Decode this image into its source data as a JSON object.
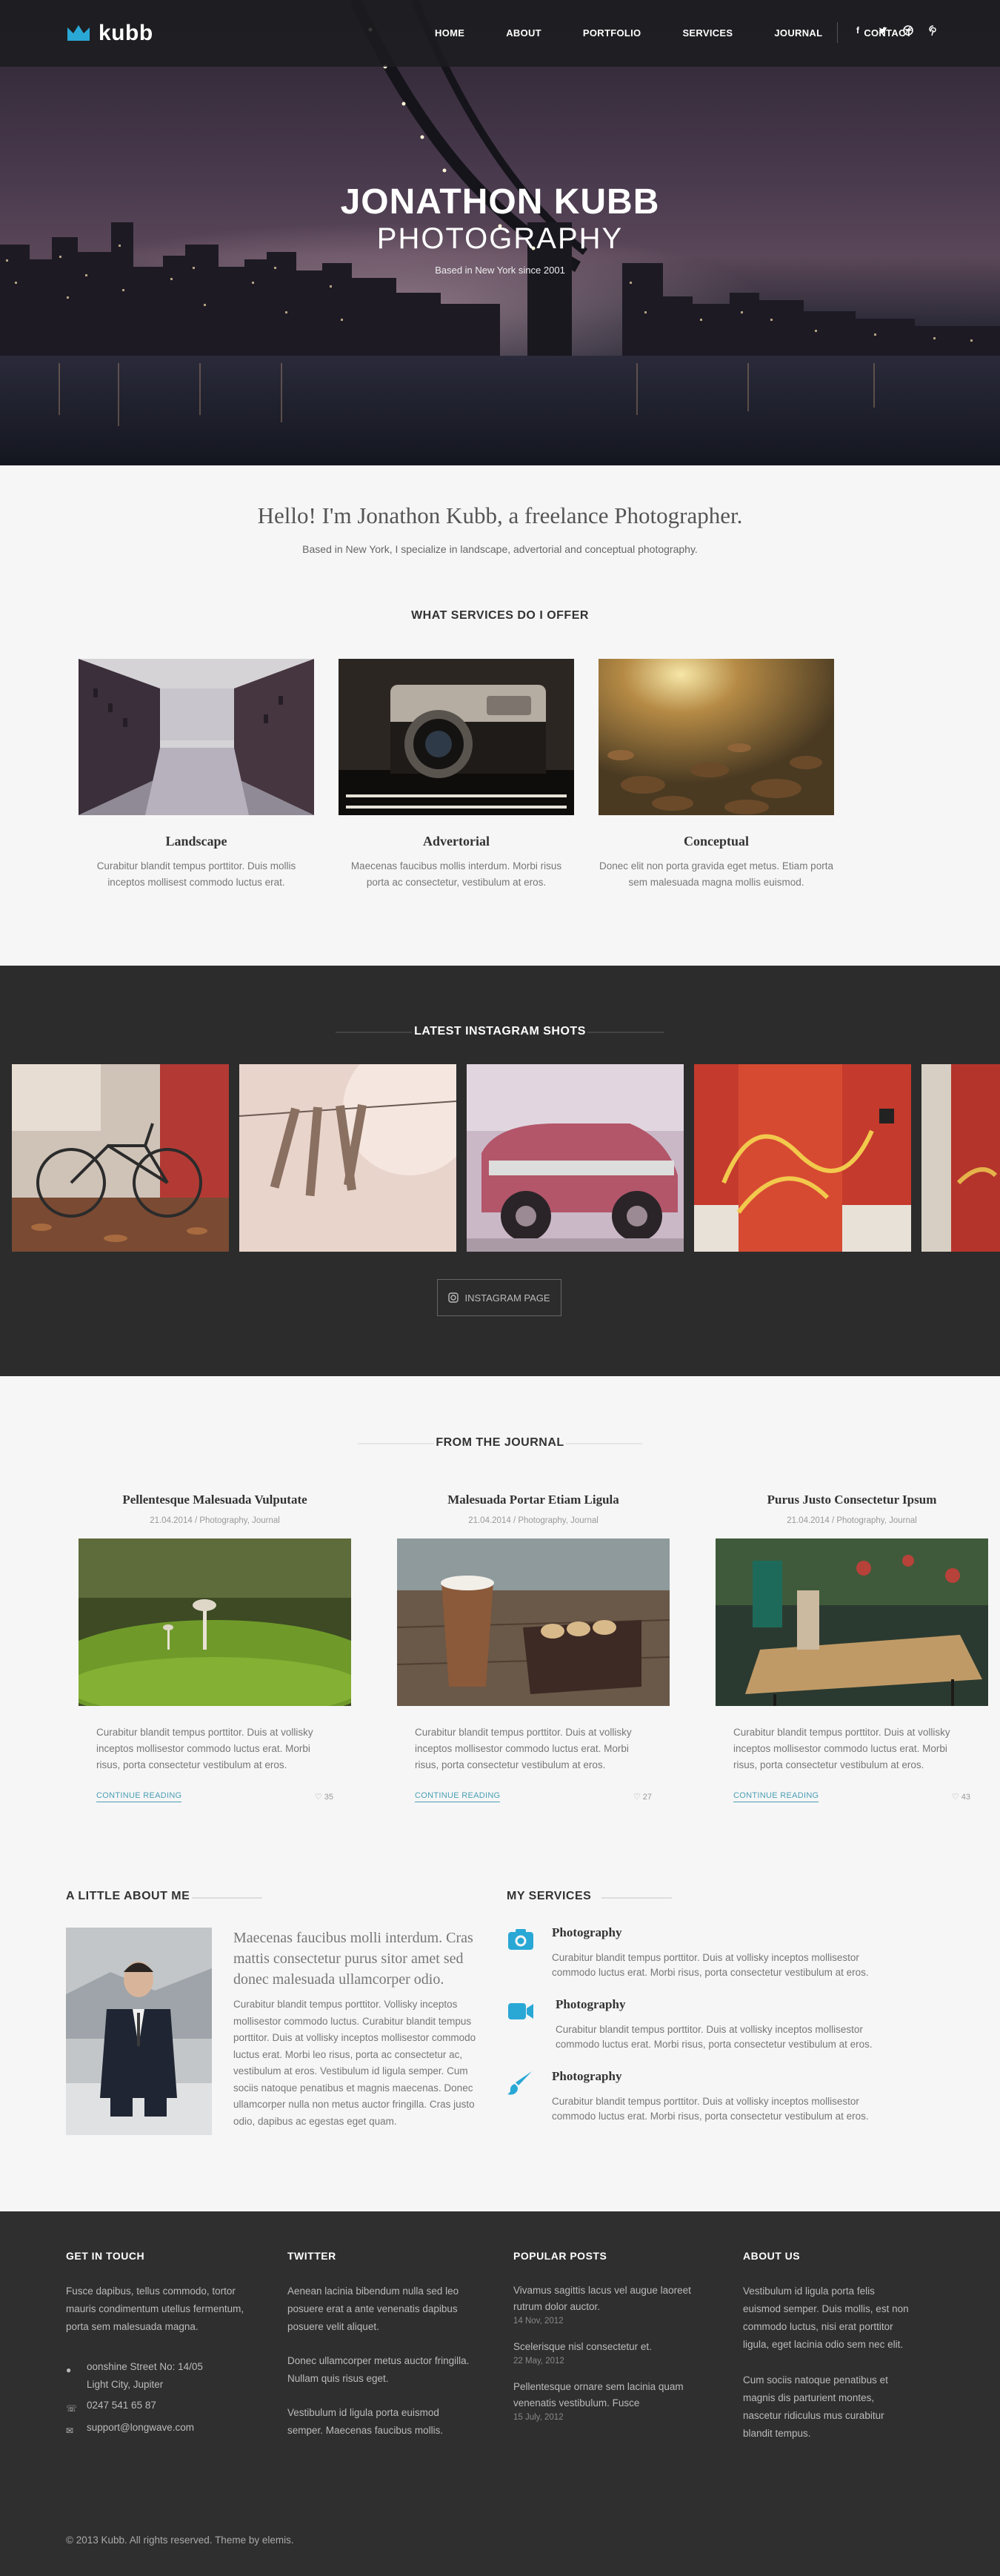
{
  "brand": {
    "name": "kubb"
  },
  "nav": {
    "items": [
      "HOME",
      "ABOUT",
      "PORTFOLIO",
      "SERVICES",
      "JOURNAL",
      "CONTACT"
    ],
    "social": [
      "f",
      "t",
      "d",
      "p"
    ]
  },
  "hero": {
    "title": "JONATHON KUBB",
    "subtitle": "PHOTOGRAPHY",
    "tagline": "Based in New York since 2001"
  },
  "intro": {
    "heading": "Hello! I'm Jonathon Kubb, a freelance Photographer.",
    "text": "Based in New York, I specialize in landscape, advertorial and conceptual photography."
  },
  "services": {
    "title": "WHAT SERVICES DO I OFFER",
    "items": [
      {
        "name": "Landscape",
        "desc": "Curabitur blandit tempus porttitor. Duis mollis inceptos mollisest commodo luctus erat."
      },
      {
        "name": "Advertorial",
        "desc": "Maecenas faucibus mollis interdum. Morbi risus porta ac consectetur, vestibulum at eros."
      },
      {
        "name": "Conceptual",
        "desc": "Donec elit non porta gravida eget metus. Etiam porta sem malesuada magna mollis euismod."
      }
    ]
  },
  "instagram": {
    "title": "LATEST INSTAGRAM SHOTS",
    "button": "INSTAGRAM PAGE"
  },
  "journal": {
    "title": "FROM THE JOURNAL",
    "posts": [
      {
        "title": "Pellentesque Malesuada Vulputate",
        "meta": "21.04.2014 / Photography, Journal",
        "excerpt": "Curabitur blandit tempus porttitor. Duis at vollisky inceptos mollisestor commodo luctus erat. Morbi risus, porta consectetur vestibulum at eros.",
        "more": "CONTINUE READING",
        "likes": "35"
      },
      {
        "title": "Malesuada Portar Etiam Ligula",
        "meta": "21.04.2014 / Photography, Journal",
        "excerpt": "Curabitur blandit tempus porttitor. Duis at vollisky inceptos mollisestor commodo luctus erat. Morbi risus, porta consectetur vestibulum at eros.",
        "more": "CONTINUE READING",
        "likes": "27"
      },
      {
        "title": "Purus Justo Consectetur Ipsum",
        "meta": "21.04.2014 / Photography, Journal",
        "excerpt": "Curabitur blandit tempus porttitor. Duis at vollisky inceptos mollisestor commodo luctus erat. Morbi risus, porta consectetur vestibulum at eros.",
        "more": "CONTINUE READING",
        "likes": "43"
      }
    ]
  },
  "about": {
    "title": "A LITTLE ABOUT ME",
    "lead": "Maecenas faucibus molli interdum. Cras mattis consectetur purus sitor amet sed donec malesuada ullamcorper odio.",
    "text": "Curabitur blandit tempus porttitor. Vollisky inceptos mollisestor commodo luctus. Curabitur blandit tempus porttitor. Duis at vollisky inceptos mollisestor commodo luctus erat. Morbi leo risus, porta ac consectetur ac, vestibulum at eros. Vestibulum id ligula semper. Cum sociis natoque penatibus et magnis maecenas. Donec ullamcorper nulla non metus auctor fringilla. Cras justo odio, dapibus ac egestas eget quam."
  },
  "my_services": {
    "title": "MY SERVICES",
    "items": [
      {
        "icon": "camera-icon",
        "title": "Photography",
        "text": "Curabitur blandit tempus porttitor. Duis at vollisky inceptos mollisestor commodo luctus erat. Morbi risus, porta consectetur vestibulum at eros."
      },
      {
        "icon": "video-icon",
        "title": "Photography",
        "text": "Curabitur blandit tempus porttitor. Duis at vollisky inceptos mollisestor commodo luctus erat. Morbi risus, porta consectetur vestibulum at eros."
      },
      {
        "icon": "brush-icon",
        "title": "Photography",
        "text": "Curabitur blandit tempus porttitor. Duis at vollisky inceptos mollisestor commodo luctus erat. Morbi risus, porta consectetur vestibulum at eros."
      }
    ]
  },
  "footer": {
    "contact": {
      "title": "GET IN TOUCH",
      "text": "Fusce dapibus, tellus commodo, tortor mauris condimentum utellus fermentum, porta sem malesuada magna.",
      "address_line1": "oonshine Street No: 14/05",
      "address_line2": "Light City, Jupiter",
      "phone": "0247 541 65 87",
      "email": "support@longwave.com"
    },
    "twitter": {
      "title": "TWITTER",
      "tweets": [
        "Aenean lacinia bibendum nulla sed leo posuere erat a ante venenatis dapibus posuere velit aliquet.",
        "Donec ullamcorper metus auctor fringilla. Nullam quis risus eget.",
        "Vestibulum id ligula porta euismod semper. Maecenas faucibus mollis."
      ]
    },
    "popular": {
      "title": "POPULAR POSTS",
      "posts": [
        {
          "title": "Vivamus sagittis lacus vel augue laoreet rutrum dolor auctor.",
          "date": "14 Nov, 2012"
        },
        {
          "title": "Scelerisque nisl consectetur et.",
          "date": "22 May, 2012"
        },
        {
          "title": "Pellentesque ornare sem lacinia quam venenatis vestibulum. Fusce",
          "date": "15 July, 2012"
        }
      ]
    },
    "about": {
      "title": "ABOUT US",
      "p1": "Vestibulum id ligula porta felis euismod semper. Duis mollis, est non commodo luctus, nisi erat porttitor ligula, eget lacinia odio sem nec elit.",
      "p2": "Cum sociis natoque penatibus et magnis dis parturient montes, nascetur ridiculus mus curabitur blandit tempus."
    },
    "copyright": "© 2013 Kubb. All rights reserved. Theme by elemis."
  },
  "colors": {
    "accent": "#29a8d6",
    "dark": "#2c2c2c",
    "footer": "#2f2f2f"
  }
}
